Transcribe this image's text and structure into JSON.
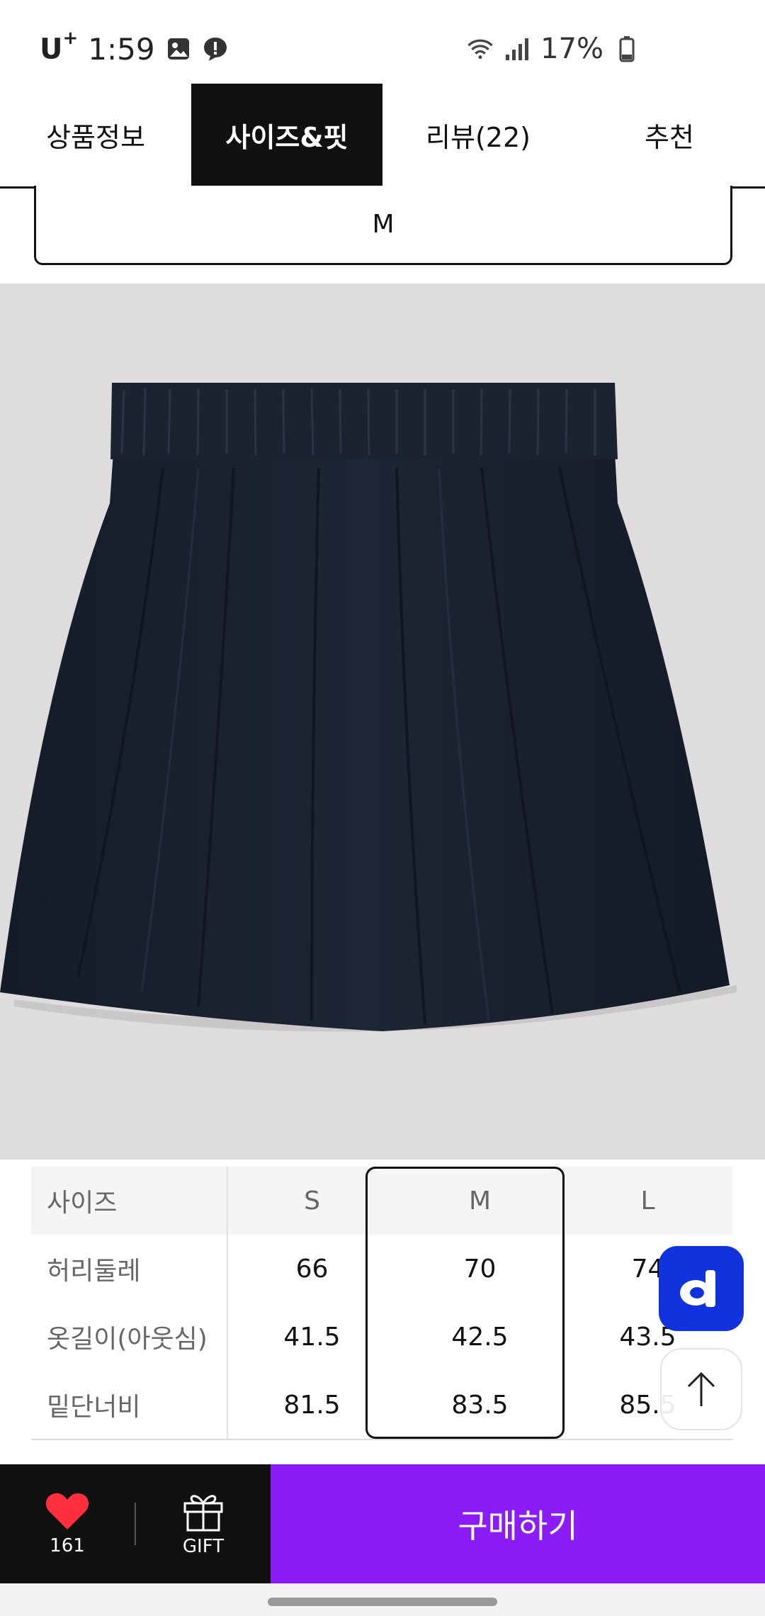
{
  "status_bar": {
    "carrier": "U",
    "carrier_sup": "+",
    "time": "1:59",
    "battery": "17%"
  },
  "tabs": [
    {
      "label": "상품정보",
      "active": false
    },
    {
      "label": "사이즈&핏",
      "active": true
    },
    {
      "label": "리뷰(22)",
      "active": false
    },
    {
      "label": "추천",
      "active": false
    }
  ],
  "size_select": {
    "value": "M"
  },
  "size_table": {
    "header": {
      "label": "사이즈",
      "values": [
        "S",
        "M",
        "L"
      ]
    },
    "rows": [
      {
        "label": "허리둘레",
        "values": [
          "66",
          "70",
          "74"
        ]
      },
      {
        "label": "옷길이(아웃심)",
        "values": [
          "41.5",
          "42.5",
          "43.5"
        ]
      },
      {
        "label": "밑단너비",
        "values": [
          "81.5",
          "83.5",
          "85.5"
        ]
      }
    ],
    "selected_size": "M"
  },
  "floating": {
    "d_button_label": "d"
  },
  "bottom_bar": {
    "like_count": "161",
    "gift_label": "GIFT",
    "buy_label": "구매하기"
  },
  "colors": {
    "accent_purple": "#8b1cf5",
    "fab_blue": "#1133dd",
    "heart_red": "#ff2f3d",
    "skirt_navy": "#1a2230"
  }
}
